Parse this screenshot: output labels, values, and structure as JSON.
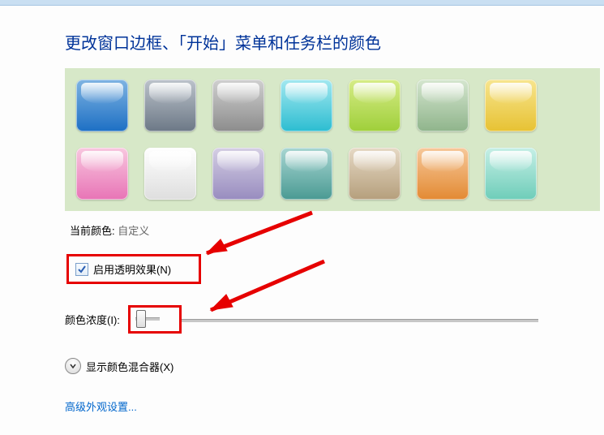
{
  "page_title": "更改窗口边框、「开始」菜单和任务栏的颜色",
  "swatches": [
    {
      "name": "deep-blue",
      "grad_top": "#7fb4e2",
      "grad_bot": "#1d6fc4"
    },
    {
      "name": "slate",
      "grad_top": "#bcc3cb",
      "grad_bot": "#6c7886"
    },
    {
      "name": "gray",
      "grad_top": "#d0d0d0",
      "grad_bot": "#8c8c8c"
    },
    {
      "name": "cyan",
      "grad_top": "#a3e8f0",
      "grad_bot": "#2cbdd1"
    },
    {
      "name": "lime",
      "grad_top": "#d6ec87",
      "grad_bot": "#9fcf3a"
    },
    {
      "name": "sage",
      "grad_top": "#d5e6cf",
      "grad_bot": "#8fb48b"
    },
    {
      "name": "yellow",
      "grad_top": "#f7e58f",
      "grad_bot": "#e7c233"
    },
    {
      "name": "pink",
      "grad_top": "#f8c7df",
      "grad_bot": "#e874b6"
    },
    {
      "name": "white",
      "grad_top": "#ffffff",
      "grad_bot": "#dedede"
    },
    {
      "name": "lavender",
      "grad_top": "#d5cfe4",
      "grad_bot": "#988cbf"
    },
    {
      "name": "teal",
      "grad_top": "#a8d6d2",
      "grad_bot": "#4a9a93"
    },
    {
      "name": "tan",
      "grad_top": "#e6d9c5",
      "grad_bot": "#b59f7c"
    },
    {
      "name": "orange",
      "grad_top": "#f6c89a",
      "grad_bot": "#e38a33"
    },
    {
      "name": "aqua",
      "grad_top": "#c6efe6",
      "grad_bot": "#6ecdb9"
    }
  ],
  "current_color": {
    "label": "当前颜色:",
    "value": "自定义"
  },
  "transparency": {
    "label": "启用透明效果(N)",
    "checked": true
  },
  "intensity": {
    "label": "颜色浓度(I):",
    "value_percent": 4
  },
  "mixer": {
    "label": "显示颜色混合器(X)"
  },
  "advanced_link": "高级外观设置...",
  "annotations": {
    "highlight_color": "#e60000"
  }
}
